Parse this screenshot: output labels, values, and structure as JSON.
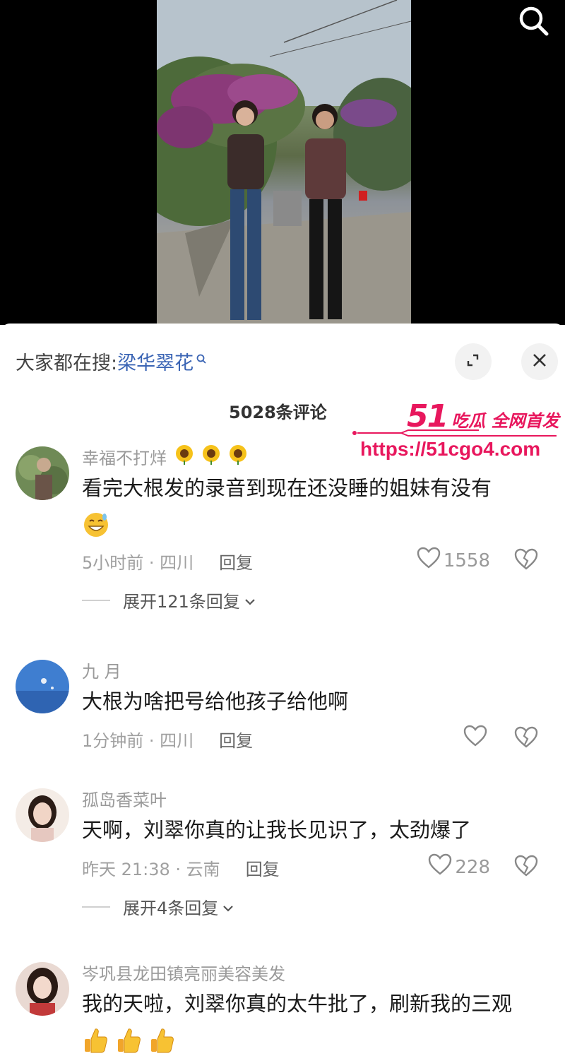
{
  "hot_search": {
    "prefix": "大家都在搜:",
    "keyword": "梁华翠花",
    "keyword_icon": "search-small-icon"
  },
  "comment_count": "5028条评论",
  "watermark": {
    "brand_num": "51",
    "brand_text": "吃瓜 全网首发",
    "url": "https://51cgo4.com"
  },
  "icons": {
    "search": "search-icon",
    "expand": "expand-icon",
    "close": "close-icon",
    "like": "heart-icon",
    "dislike": "broken-heart-icon"
  },
  "colors": {
    "link": "#3a64b4",
    "watermark": "#e8175d",
    "muted": "#9a9a9a"
  },
  "comments": [
    {
      "user": "幸福不打烊",
      "user_emojis": [
        "sunflower",
        "sunflower",
        "sunflower"
      ],
      "text": "看完大根发的录音到现在还没睡的姐妹有没有",
      "text_emoji": "grin-sweat",
      "time_location": "5小时前 · 四川",
      "reply_label": "回复",
      "likes": "1558",
      "expand_label": "展开121条回复"
    },
    {
      "user": "九 月",
      "text": "大根为啥把号给他孩子给他啊",
      "time_location": "1分钟前 · 四川",
      "reply_label": "回复",
      "likes": ""
    },
    {
      "user": "孤岛香菜叶",
      "text": "天啊，刘翠你真的让我长见识了，太劲爆了",
      "time_location": "昨天 21:38 · 云南",
      "reply_label": "回复",
      "likes": "228",
      "expand_label": "展开4条回复"
    },
    {
      "user": "岑巩县龙田镇亮丽美容美发",
      "text": "我的天啦，刘翠你真的太牛批了，刷新我的三观",
      "text_emojis": [
        "thumbs-up",
        "thumbs-up",
        "thumbs-up"
      ]
    }
  ]
}
